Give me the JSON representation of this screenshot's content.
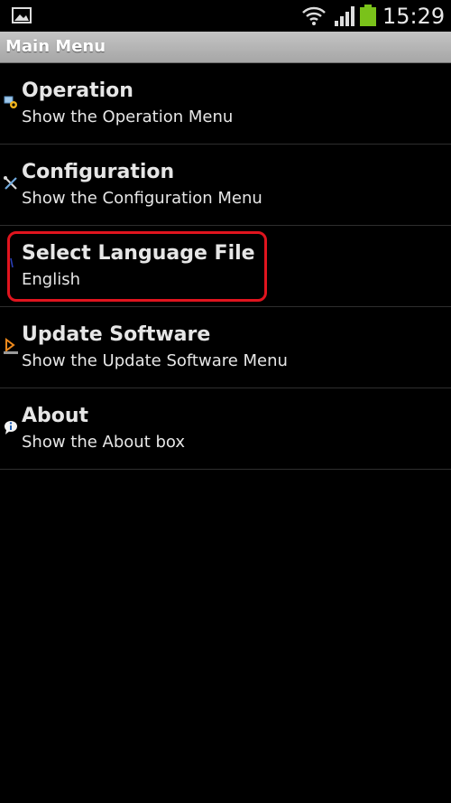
{
  "status_bar": {
    "time": "15:29",
    "icons": [
      "image-notification-icon",
      "wifi-icon",
      "signal-icon",
      "battery-icon"
    ],
    "battery_color": "#7ac21a"
  },
  "title_bar": {
    "title": "Main Menu"
  },
  "menu": {
    "items": [
      {
        "title": "Operation",
        "subtitle": "Show the Operation Menu",
        "icon": "operation-icon"
      },
      {
        "title": "Configuration",
        "subtitle": "Show the Configuration Menu",
        "icon": "tools-icon"
      },
      {
        "title": "Select Language File",
        "subtitle": "English",
        "icon": "language-icon",
        "highlighted": true
      },
      {
        "title": "Update Software",
        "subtitle": "Show the Update Software Menu",
        "icon": "update-icon"
      },
      {
        "title": "About",
        "subtitle": "Show the About box",
        "icon": "info-icon"
      }
    ]
  },
  "colors": {
    "background": "#000000",
    "highlight": "#e0141e",
    "title_bar": "#b3b3b3"
  }
}
